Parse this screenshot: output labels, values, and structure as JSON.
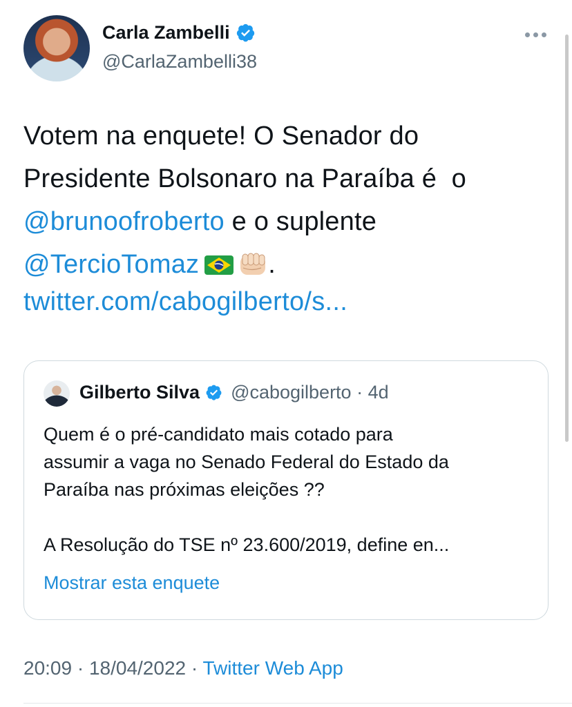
{
  "author": {
    "name": "Carla Zambelli",
    "handle": "@CarlaZambelli38",
    "verified_icon": "verified-badge-icon"
  },
  "tweet": {
    "line1": "Votem na enquete! O Senador do",
    "line2": "Presidente Bolsonaro na Paraíba é  o",
    "mention1": "@brunoofroberto",
    "line3_rest": " e o suplente",
    "mention2": "@TercioTomaz",
    "emojis": [
      "brazil-flag-emoji",
      "oncoming-fist-emoji"
    ],
    "end_punct": ".",
    "link": "twitter.com/cabogilberto/s..."
  },
  "quote": {
    "name": "Gilberto Silva",
    "handle_time": "@cabogilberto · 4d",
    "text_lines": [
      "Quem é o pré-candidato mais cotado para",
      "assumir a vaga no Senado Federal do Estado da",
      "Paraíba nas próximas eleições ??",
      "A Resolução do TSE nº 23.600/2019, define en..."
    ],
    "poll_link": "Mostrar esta enquete"
  },
  "meta": {
    "time_date": "20:09 · 18/04/2022 · ",
    "source": "Twitter Web App"
  },
  "colors": {
    "link": "#1d8cd8",
    "verified": "#1d9bf0",
    "secondary_text": "#536471",
    "border": "#cfd9de"
  }
}
